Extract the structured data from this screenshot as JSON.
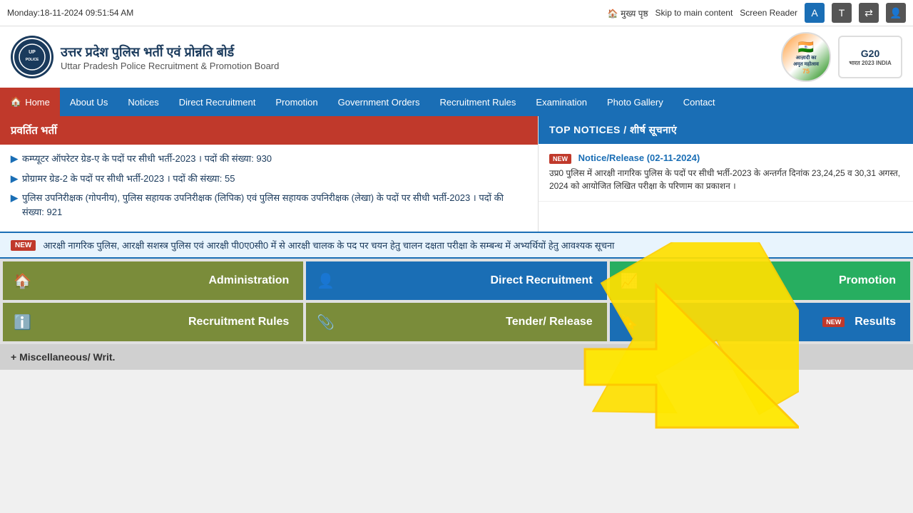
{
  "topbar": {
    "datetime": "Monday:18-11-2024 09:51:54 AM",
    "home_link": "🏠 मुख्य पृष्ठ",
    "skip_link": "Skip to main content",
    "screen_reader": "Screen Reader"
  },
  "header": {
    "title_hi": "उत्तर प्रदेश पुलिस भर्ती एवं प्रोन्नति बोर्ड",
    "title_en": "Uttar Pradesh Police Recruitment & Promotion Board"
  },
  "navbar": {
    "items": [
      {
        "label": "Home",
        "active": true
      },
      {
        "label": "About Us",
        "active": false
      },
      {
        "label": "Notices",
        "active": false
      },
      {
        "label": "Direct Recruitment",
        "active": false
      },
      {
        "label": "Promotion",
        "active": false
      },
      {
        "label": "Government Orders",
        "active": false
      },
      {
        "label": "Recruitment Rules",
        "active": false
      },
      {
        "label": "Examination",
        "active": false
      },
      {
        "label": "Photo Gallery",
        "active": false
      },
      {
        "label": "Contact",
        "active": false
      }
    ]
  },
  "pravrit": {
    "title": "प्रवर्तित भर्ती",
    "items": [
      "कम्प्यूटर ऑपरेटर ग्रेड-ए के पदों पर सीधी भर्ती-2023 । पदों की संख्या: 930",
      "प्रोग्रामर ग्रेड-2 के पदों पर सीधी भर्ती-2023 । पदों की संख्या: 55",
      "पुलिस उपनिरीक्षक (गोपनीय), पुलिस सहायक उपनिरीक्षक (लिपिक) एवं पुलिस सहायक उपनिरीक्षक (लेखा) के पदों पर सीधी भर्ती-2023 । पदों की संख्या: 921"
    ]
  },
  "top_notices": {
    "title": "TOP NOTICES / शीर्ष सूचनाएं",
    "items": [
      {
        "badge": "NEW",
        "title": "Notice/Release (02-11-2024)",
        "text": "उप्र0 पुलिस में आरक्षी नागरिक पुलिस के पदों पर सीधी भर्ती-2023 के अन्तर्गत दिनांक 23,24,25 व 30,31 अगस्त, 2024 को आयोजित लिखित परीक्षा के परिणाम का प्रकाशन ।"
      }
    ]
  },
  "ticker": {
    "badge": "NEW",
    "text": "आरक्षी नागरिक पुलिस, आरक्षी सशस्त्र पुलिस एवं आरक्षी पी0ए0सी0 में से आरक्षी चालक के पद पर चयन हेतु चालन दक्षता परीक्षा के सम्बन्ध में अभ्यर्थियों हेतु आवश्यक सूचना"
  },
  "quick_links": [
    {
      "label": "Administration",
      "icon": "🏠",
      "bg": "olive"
    },
    {
      "label": "Direct Recruitment",
      "icon": "👤",
      "bg": "blue"
    },
    {
      "label": "Promotion",
      "icon": "📈",
      "bg": "green"
    },
    {
      "label": "Recruitment Rules",
      "icon": "ℹ️",
      "bg": "olive"
    },
    {
      "label": "Tender/ Release",
      "icon": "📎",
      "bg": "olive"
    },
    {
      "label": "Results",
      "icon": "🔖",
      "bg": "blue",
      "badge": "NEW"
    }
  ],
  "misc": {
    "label": "+ Miscellaneous/ Writ."
  }
}
